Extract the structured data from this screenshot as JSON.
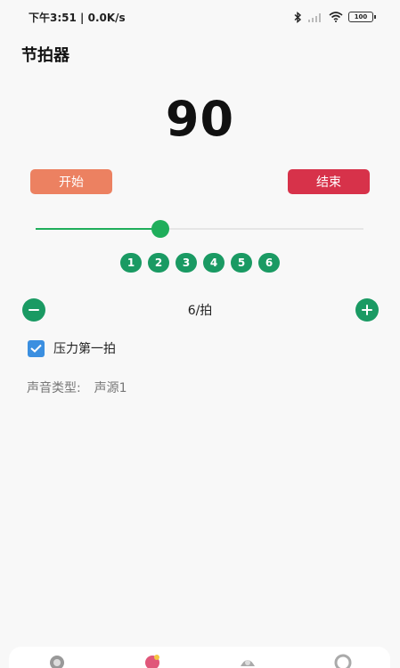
{
  "status_bar": {
    "time": "下午3:51",
    "network_speed": "0.0K/s",
    "battery": "100",
    "icons": [
      "bluetooth-icon",
      "signal-icon",
      "wifi-icon",
      "battery-icon"
    ]
  },
  "app": {
    "title": "节拍器"
  },
  "tempo": {
    "bpm": "90",
    "slider_fraction": 0.38
  },
  "controls": {
    "start_label": "开始",
    "stop_label": "结束"
  },
  "beat_indicators": [
    "1",
    "2",
    "3",
    "4",
    "5",
    "6"
  ],
  "beats": {
    "label": "6/拍"
  },
  "accent": {
    "checked": true,
    "label": "压力第一拍"
  },
  "sound": {
    "label": "声音类型:",
    "value": "声源1"
  },
  "colors": {
    "accent_green": "#1a9a63",
    "start_button": "#ec8161",
    "stop_button": "#d7324a",
    "checkbox": "#3b8fe0"
  },
  "bottom_nav": [
    "nav-icon-1",
    "nav-icon-2",
    "nav-icon-3",
    "nav-icon-4"
  ]
}
